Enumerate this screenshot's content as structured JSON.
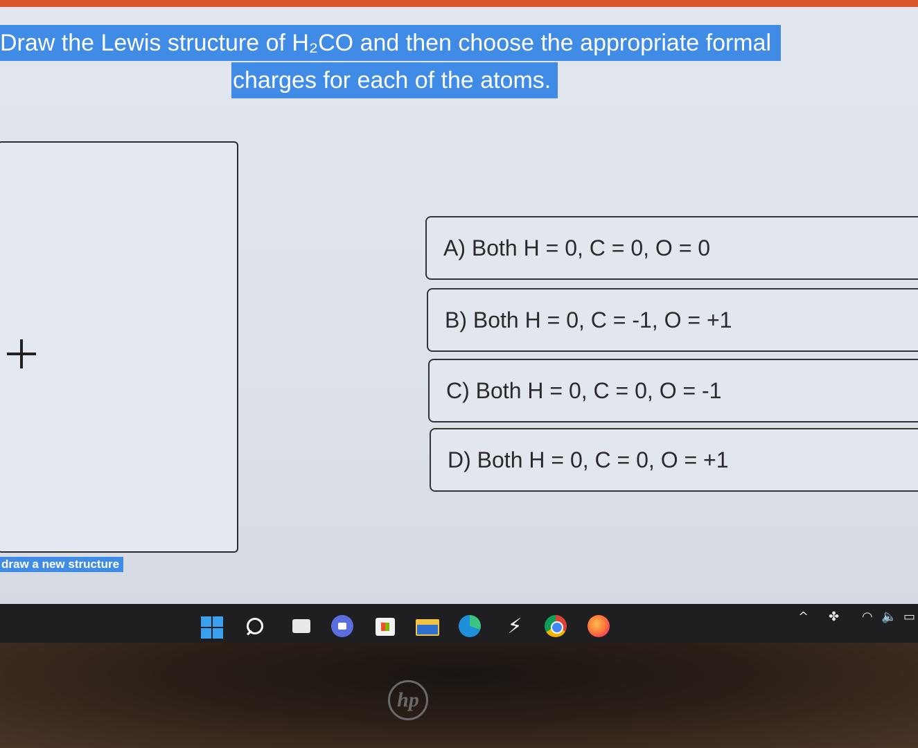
{
  "question": {
    "line1": "Draw the Lewis structure of H₂CO and then choose the appropriate formal",
    "line2": "charges for each of the atoms."
  },
  "canvas": {
    "add_icon": "plus-icon",
    "new_structure_label": "draw a new structure"
  },
  "options": [
    {
      "label": "A) Both H = 0, C = 0, O = 0"
    },
    {
      "label": "B) Both H = 0, C = -1, O = +1"
    },
    {
      "label": "C) Both H = 0, C = 0, O = -1"
    },
    {
      "label": "D) Both H = 0, C = 0, O = +1"
    }
  ],
  "taskbar": {
    "icons": [
      "windows-start-icon",
      "search-icon",
      "task-view-icon",
      "chat-icon",
      "store-icon",
      "file-explorer-icon",
      "edge-icon",
      "bolt-app-icon",
      "chrome-icon",
      "firefox-icon"
    ],
    "tray": {
      "chevron": "^",
      "wifi": "wifi-icon",
      "volume": "volume-icon",
      "battery": "battery-icon"
    }
  },
  "bezel": {
    "logo": "hp"
  },
  "colors": {
    "highlight": "#3f8be6",
    "accent_bar": "#d9542b"
  }
}
